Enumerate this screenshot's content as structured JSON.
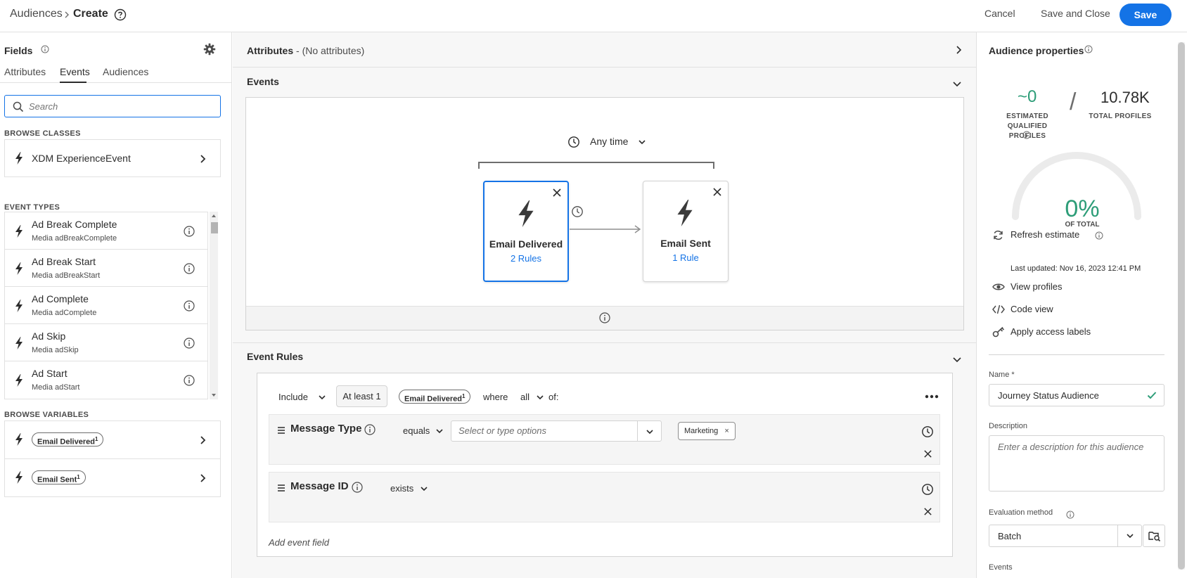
{
  "topbar": {
    "breadcrumb_root": "Audiences",
    "breadcrumb_current": "Create",
    "cancel_label": "Cancel",
    "save_close_label": "Save and Close",
    "save_label": "Save",
    "accent": "#1473e6"
  },
  "fields_panel": {
    "title": "Fields",
    "tabs": [
      {
        "label": "Attributes"
      },
      {
        "label": "Events"
      },
      {
        "label": "Audiences"
      }
    ],
    "active_tab": "Events",
    "search_placeholder": "Search",
    "browse_classes_label": "BROWSE CLASSES",
    "browse_classes": [
      {
        "label": "XDM ExperienceEvent"
      }
    ],
    "event_types_label": "EVENT TYPES",
    "event_types": [
      {
        "name": "Ad Break Complete",
        "sub": "Media adBreakComplete"
      },
      {
        "name": "Ad Break Start",
        "sub": "Media adBreakStart"
      },
      {
        "name": "Ad Complete",
        "sub": "Media adComplete"
      },
      {
        "name": "Ad Skip",
        "sub": "Media adSkip"
      },
      {
        "name": "Ad Start",
        "sub": "Media adStart"
      }
    ],
    "browse_variables_label": "BROWSE VARIABLES",
    "variables": [
      {
        "label": "Email Delivered",
        "sup": "1"
      },
      {
        "label": "Email Sent",
        "sup": "1"
      }
    ]
  },
  "center": {
    "attributes_title": "Attributes",
    "attributes_sub": " - (No attributes)",
    "events_title": "Events",
    "anytime_label": "Any time",
    "nodes": [
      {
        "title": "Email Delivered",
        "rules": "2 Rules",
        "selected": true
      },
      {
        "title": "Email Sent",
        "rules": "1 Rule",
        "selected": false
      }
    ],
    "event_rules_title": "Event Rules",
    "rule_header": {
      "include": "Include",
      "at_least": "At least 1",
      "event_pill": "Email Delivered",
      "event_pill_sup": "1",
      "where": "where",
      "all": "all",
      "of": "of:"
    },
    "rules": [
      {
        "field": "Message Type",
        "operator": "equals",
        "value_placeholder": "Select or type options",
        "tag": "Marketing"
      },
      {
        "field": "Message ID",
        "operator": "exists"
      }
    ],
    "add_event_field": "Add event field"
  },
  "properties": {
    "title": "Audience properties",
    "estimated_value": "~0",
    "estimated_label_1": "ESTIMATED",
    "estimated_label_2": "QUALIFIED PROFILES",
    "slash": "/",
    "total_value": "10.78K",
    "total_label": "TOTAL PROFILES",
    "percent": "0%",
    "percent_label": "OF TOTAL",
    "gauge_fill": 0,
    "refresh_label": "Refresh estimate",
    "last_updated": "Last updated: Nov 16, 2023 12:41 PM",
    "view_profiles": "View profiles",
    "code_view": "Code view",
    "apply_access": "Apply access labels",
    "name_label": "Name *",
    "name_value": "Journey Status Audience",
    "description_label": "Description",
    "description_placeholder": "Enter a description for this audience",
    "evaluation_label": "Evaluation method",
    "evaluation_value": "Batch",
    "events_label": "Events",
    "success_color": "#2d9d78"
  }
}
